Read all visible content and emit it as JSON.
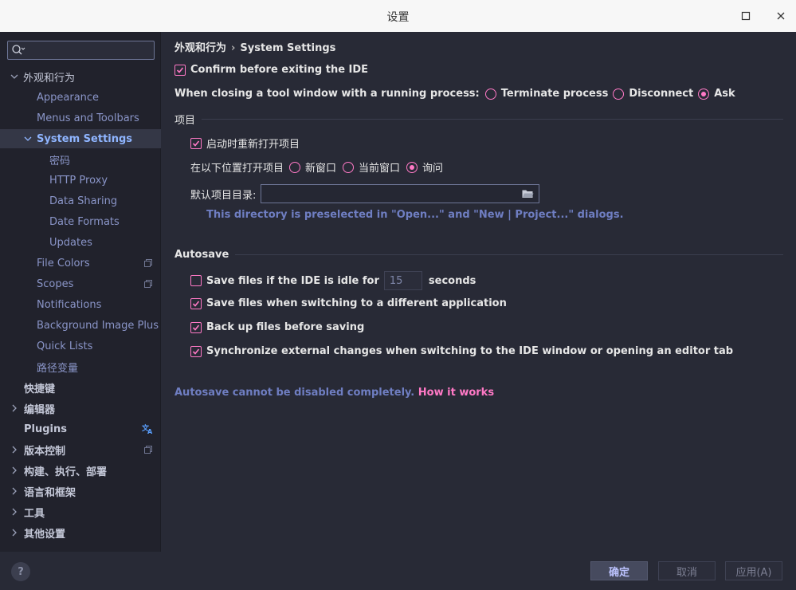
{
  "window": {
    "title": "设置"
  },
  "sidebar": {
    "items": [
      {
        "label": "外观和行为",
        "expanded": true
      },
      {
        "label": "Appearance"
      },
      {
        "label": "Menus and Toolbars"
      },
      {
        "label": "System Settings",
        "selected": true,
        "expanded": true
      },
      {
        "label": "密码"
      },
      {
        "label": "HTTP Proxy"
      },
      {
        "label": "Data Sharing"
      },
      {
        "label": "Date Formats"
      },
      {
        "label": "Updates"
      },
      {
        "label": "File Colors"
      },
      {
        "label": "Scopes"
      },
      {
        "label": "Notifications"
      },
      {
        "label": "Background Image Plus"
      },
      {
        "label": "Quick Lists"
      },
      {
        "label": "路径变量"
      },
      {
        "label": "快捷键"
      },
      {
        "label": "编辑器"
      },
      {
        "label": "Plugins"
      },
      {
        "label": "版本控制"
      },
      {
        "label": "构建、执行、部署"
      },
      {
        "label": "语言和框架"
      },
      {
        "label": "工具"
      },
      {
        "label": "其他设置"
      }
    ]
  },
  "breadcrumb": {
    "parent": "外观和行为",
    "separator": "›",
    "current": "System Settings"
  },
  "general": {
    "confirm_exit_label": "Confirm before exiting the IDE",
    "confirm_exit_checked": true,
    "closing_label": "When closing a tool window with a running process:",
    "closing_options": [
      "Terminate process",
      "Disconnect",
      "Ask"
    ],
    "closing_selected": "Ask"
  },
  "project": {
    "section_label": "项目",
    "reopen_label": "启动时重新打开项目",
    "reopen_checked": true,
    "open_in_label": "在以下位置打开项目",
    "open_in_options": [
      "新窗口",
      "当前窗口",
      "询问"
    ],
    "open_in_selected": "询问",
    "default_dir_label": "默认项目目录:",
    "default_dir_value": "",
    "default_dir_hint": "This directory is preselected in \"Open...\" and \"New | Project...\" dialogs."
  },
  "autosave": {
    "section_label": "Autosave",
    "idle_prefix": "Save files if the IDE is idle for",
    "idle_value": "15",
    "idle_suffix": "seconds",
    "idle_checked": false,
    "switch_app_label": "Save files when switching to a different application",
    "switch_app_checked": true,
    "backup_label": "Back up files before saving",
    "backup_checked": true,
    "sync_label": "Synchronize external changes when switching to the IDE window or opening an editor tab",
    "sync_checked": true,
    "note": "Autosave cannot be disabled completely.",
    "note_link": "How it works"
  },
  "footer": {
    "help": "?",
    "ok": "确定",
    "cancel": "取消",
    "apply": "应用(A)"
  },
  "colors": {
    "accent": "#ff79c6",
    "background": "#282a36",
    "sidebar": "#21222c",
    "selected_text": "#8fb5ff"
  }
}
